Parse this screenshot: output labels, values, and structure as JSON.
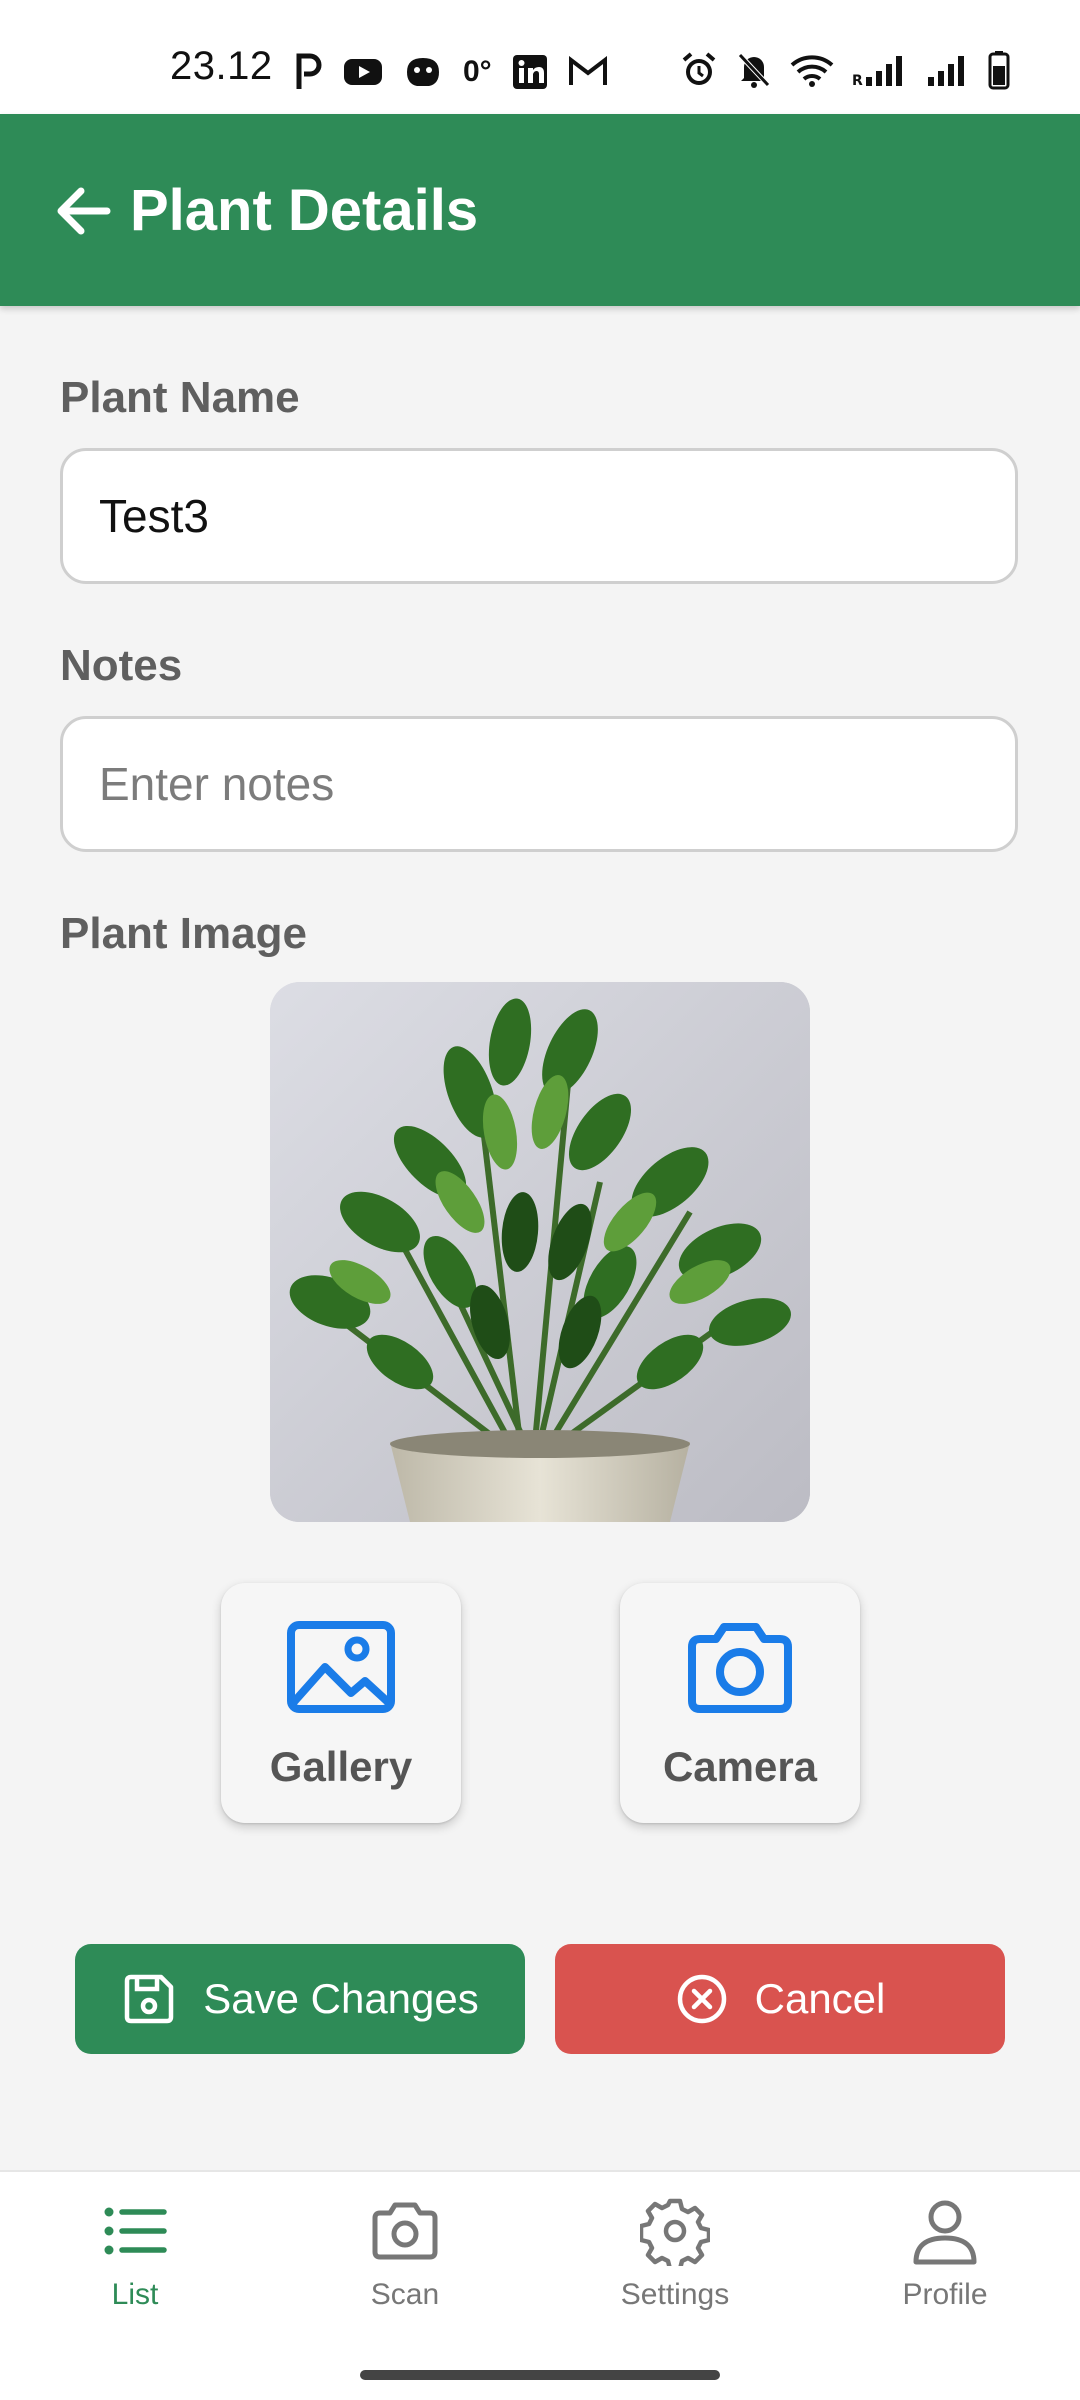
{
  "status_bar": {
    "time": "23.12",
    "temp_indicator": "0°",
    "battery": ""
  },
  "app_bar": {
    "title": "Plant Details"
  },
  "form": {
    "name_label": "Plant Name",
    "name_value": "Test3",
    "notes_label": "Notes",
    "notes_value": "",
    "notes_placeholder": "Enter notes",
    "image_label": "Plant Image"
  },
  "image_sources": {
    "gallery_label": "Gallery",
    "camera_label": "Camera"
  },
  "actions": {
    "save_label": "Save Changes",
    "cancel_label": "Cancel"
  },
  "bottom_nav": {
    "items": [
      {
        "label": "List",
        "icon": "list-icon",
        "active": true
      },
      {
        "label": "Scan",
        "icon": "camera-icon",
        "active": false
      },
      {
        "label": "Settings",
        "icon": "gear-icon",
        "active": false
      },
      {
        "label": "Profile",
        "icon": "person-icon",
        "active": false
      }
    ]
  },
  "colors": {
    "primary": "#2e8b57",
    "danger": "#d9534f",
    "icon_blue": "#1a7ce8"
  }
}
